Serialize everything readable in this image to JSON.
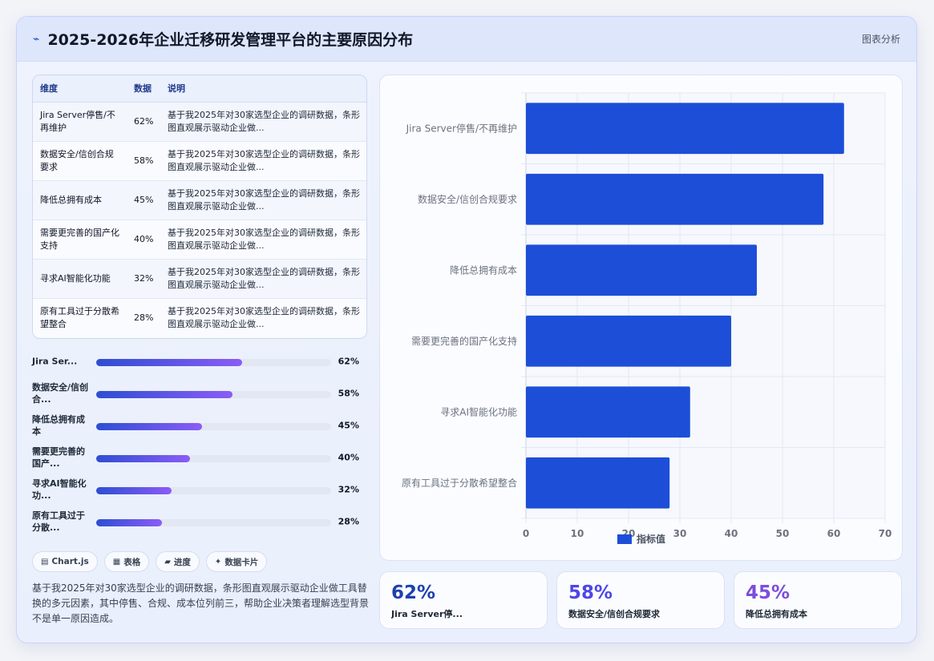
{
  "header": {
    "title": "2025-2026年企业迁移研发管理平台的主要原因分布",
    "tag": "图表分析"
  },
  "table": {
    "columns": [
      "维度",
      "数据",
      "说明"
    ],
    "rows": [
      {
        "dimension": "Jira Server停售/不再维护",
        "value": "62%",
        "note": "基于我2025年对30家选型企业的调研数据，条形图直观展示驱动企业做..."
      },
      {
        "dimension": "数据安全/信创合规要求",
        "value": "58%",
        "note": "基于我2025年对30家选型企业的调研数据，条形图直观展示驱动企业做..."
      },
      {
        "dimension": "降低总拥有成本",
        "value": "45%",
        "note": "基于我2025年对30家选型企业的调研数据，条形图直观展示驱动企业做..."
      },
      {
        "dimension": "需要更完善的国产化支持",
        "value": "40%",
        "note": "基于我2025年对30家选型企业的调研数据，条形图直观展示驱动企业做..."
      },
      {
        "dimension": "寻求AI智能化功能",
        "value": "32%",
        "note": "基于我2025年对30家选型企业的调研数据，条形图直观展示驱动企业做..."
      },
      {
        "dimension": "原有工具过于分散希望整合",
        "value": "28%",
        "note": "基于我2025年对30家选型企业的调研数据，条形图直观展示驱动企业做..."
      }
    ]
  },
  "progress": [
    {
      "label": "Jira Ser...",
      "value": 62,
      "text": "62%"
    },
    {
      "label": "数据安全/信创合...",
      "value": 58,
      "text": "58%"
    },
    {
      "label": "降低总拥有成本",
      "value": 45,
      "text": "45%"
    },
    {
      "label": "需要更完善的国产...",
      "value": 40,
      "text": "40%"
    },
    {
      "label": "寻求AI智能化功...",
      "value": 32,
      "text": "32%"
    },
    {
      "label": "原有工具过于分散...",
      "value": 28,
      "text": "28%"
    }
  ],
  "chips": [
    {
      "icon": "chart-icon",
      "label": "Chart.js"
    },
    {
      "icon": "table-icon",
      "label": "表格"
    },
    {
      "icon": "progress-icon",
      "label": "进度"
    },
    {
      "icon": "card-icon",
      "label": "数据卡片"
    }
  ],
  "description": "基于我2025年对30家选型企业的调研数据，条形图直观展示驱动企业做工具替换的多元因素，其中停售、合规、成本位列前三，帮助企业决策者理解选型背景不是单一原因造成。",
  "stats": [
    {
      "value": "62%",
      "caption": "Jira Server停...",
      "color": "#1e40af"
    },
    {
      "value": "58%",
      "caption": "数据安全/信创合规要求",
      "color": "#4f46e5"
    },
    {
      "value": "45%",
      "caption": "降低总拥有成本",
      "color": "#7c4ddb"
    }
  ],
  "chart_data": {
    "type": "bar",
    "orientation": "horizontal",
    "categories": [
      "Jira Server停售/不再维护",
      "数据安全/信创合规要求",
      "降低总拥有成本",
      "需要更完善的国产化支持",
      "寻求AI智能化功能",
      "原有工具过于分散希望整合"
    ],
    "series": [
      {
        "name": "指标值",
        "values": [
          62,
          58,
          45,
          40,
          32,
          28
        ],
        "color": "#1d4ed8"
      }
    ],
    "xlim": [
      0,
      70
    ],
    "xticks": [
      0,
      10,
      20,
      30,
      40,
      50,
      60,
      70
    ],
    "grid": true,
    "legend": "bottom"
  }
}
